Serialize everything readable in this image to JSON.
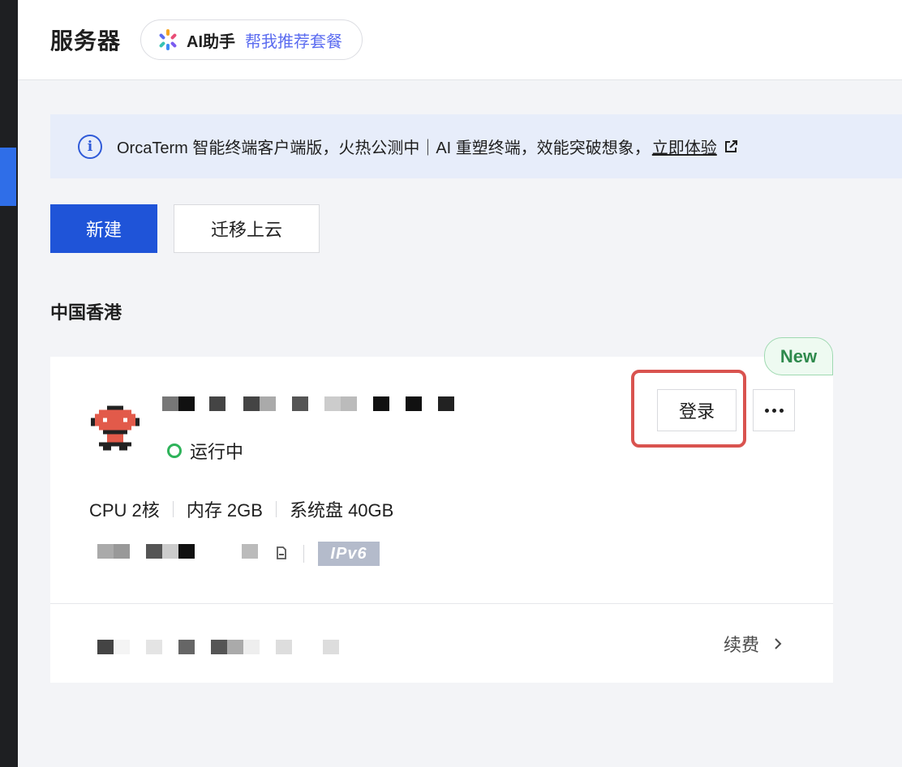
{
  "header": {
    "title": "服务器",
    "ai_assistant": {
      "label": "AI助手",
      "link": "帮我推荐套餐",
      "accent": "#5b6cf0"
    }
  },
  "notice": {
    "text": "OrcaTerm 智能终端客户端版，火热公测中｜AI 重塑终端，效能突破想象，",
    "link": "立即体验",
    "icons": [
      "info-icon",
      "external-link-icon"
    ]
  },
  "actions": {
    "create": "新建",
    "migrate": "迁移上云"
  },
  "region": "中国香港",
  "instance": {
    "badge": "New",
    "status": "运行中",
    "status_color": "#2eb35a",
    "login": "登录",
    "specs": [
      "CPU 2核",
      "内存 2GB",
      "系统盘 40GB"
    ],
    "ipv6_tag": "IPv6",
    "renew": "续费"
  },
  "colors": {
    "primary": "#1f54d8",
    "highlight_border": "#d9534f",
    "badge_green": "#2f8a4d"
  }
}
